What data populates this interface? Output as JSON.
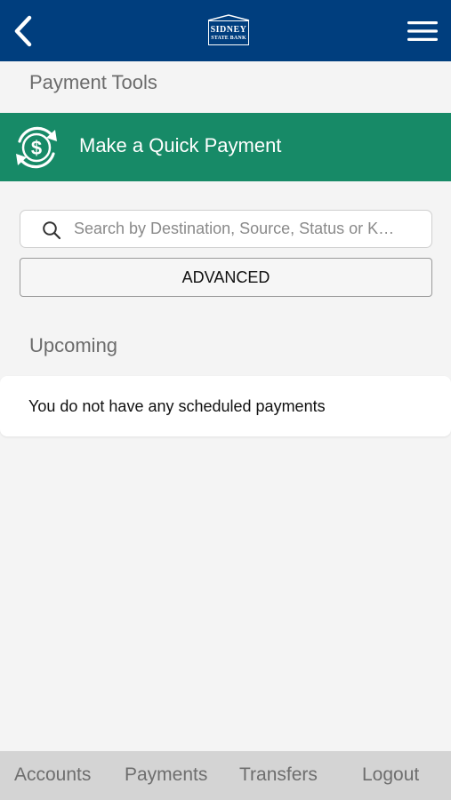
{
  "header": {
    "logo_line1": "SIDNEY",
    "logo_line2": "STATE BANK",
    "back_icon": "chevron-left-icon",
    "menu_icon": "hamburger-menu-icon"
  },
  "payment_tools": {
    "title": "Payment Tools",
    "quick_payment_label": "Make a Quick Payment",
    "quick_payment_icon": "dollar-cycle-icon"
  },
  "search": {
    "placeholder": "Search by Destination, Source, Status or K…",
    "value": ""
  },
  "advanced_label": "ADVANCED",
  "upcoming": {
    "title": "Upcoming",
    "empty_message": "You do not have any scheduled payments"
  },
  "tabs": [
    {
      "label": "Accounts"
    },
    {
      "label": "Payments"
    },
    {
      "label": "Transfers"
    },
    {
      "label": "Logout"
    }
  ],
  "colors": {
    "header_bg": "#003e7e",
    "quick_pay_bg": "#178a67",
    "tabbar_bg": "#d4d4d4",
    "page_bg": "#f4f4f4"
  }
}
